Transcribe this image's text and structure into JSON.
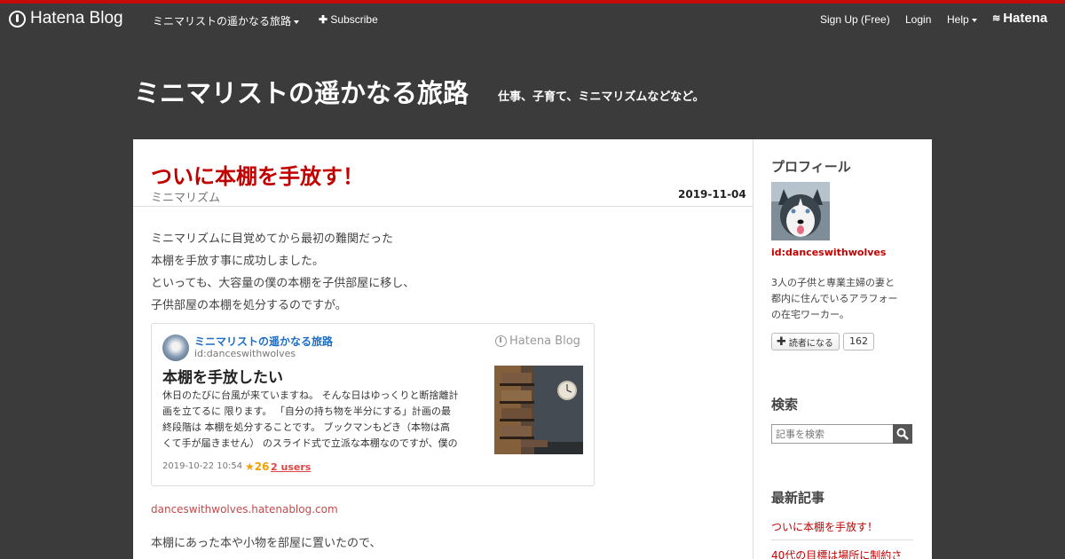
{
  "global_header": {
    "logo_text": "Hatena Blog",
    "blog_menu": "ミニマリストの遥かなる旅路",
    "subscribe": "Subscribe",
    "signup": "Sign Up (Free)",
    "login": "Login",
    "help": "Help",
    "hatena": "Hatena"
  },
  "blog": {
    "title": "ミニマリストの遥かなる旅路",
    "description": "仕事、子育て、ミニマリズムなどなど。"
  },
  "entry": {
    "title": "ついに本棚を手放す！",
    "category": "ミニマリズム",
    "date": "2019-11-04",
    "paragraphs": [
      "ミニマリズムに目覚めてから最初の難関だった",
      "本棚を手放す事に成功しました。",
      "といっても、大容量の僕の本棚を子供部屋に移し、",
      "子供部屋の本棚を処分するのですが。"
    ],
    "embed": {
      "blog_name": "ミニマリストの遥かなる旅路",
      "user_id": "id:danceswithwolves",
      "brand": "Hatena Blog",
      "title": "本棚を手放したい",
      "excerpt_lines": [
        "休日のたびに台風が来ていますね。 そんな日はゆっくりと断捨離計",
        "画を立てるに 限ります。 「自分の持ち物を半分にする」計画の最",
        "終段階は 本棚を処分することです。 ブックマンもどき（本物は高",
        "くて手が届きません） のスライド式で立派な本棚なのですが、僕の"
      ],
      "date": "2019-10-22 10:54",
      "stars": "★26",
      "users": "2 users"
    },
    "embed_link": "danceswithwolves.hatenablog.com",
    "paragraph_after": "本棚にあった本や小物を部屋に置いたので、"
  },
  "sidebar": {
    "profile_heading": "プロフィール",
    "user_id": "id:danceswithwolves",
    "bio_lines": [
      "3人の子供と専業主婦の妻と",
      "都内に住んでいるアラフォー",
      "の在宅ワーカー。"
    ],
    "follow_label": "読者になる",
    "follower_count": "162",
    "search_heading": "検索",
    "search_placeholder": "記事を検索",
    "recent_heading": "最新記事",
    "recent_items": [
      "ついに本棚を手放す！",
      "40代の目標は場所に制約さ"
    ]
  },
  "colors": {
    "accent_red": "#c10000",
    "top_line": "#c50a0a",
    "header_bg": "#3b3b3b",
    "link_blue": "#1d6ec3"
  }
}
